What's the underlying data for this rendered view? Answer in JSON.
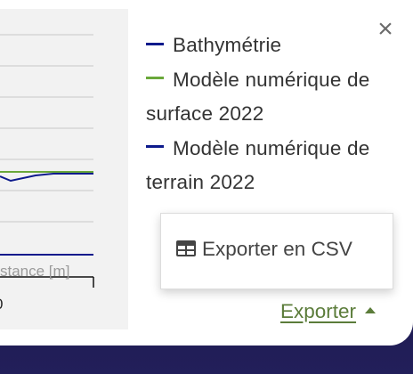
{
  "chart": {
    "xlabel": "stance [m]",
    "tick_label": "0"
  },
  "legend": {
    "items": [
      {
        "label": "Bathymétrie",
        "color": "#0d1a8c"
      },
      {
        "label": "Modèle numérique de surface 2022",
        "color": "#6aa83a"
      },
      {
        "label": "Modèle numérique de terrain 2022",
        "color": "#0d1a8c"
      }
    ]
  },
  "close": {
    "icon": "close-icon",
    "glyph": "×"
  },
  "export_menu": {
    "items": [
      {
        "label": "Exporter en CSV",
        "icon": "table-icon"
      }
    ]
  },
  "export_toggle": {
    "label": "Exporter",
    "icon": "caret-up-icon"
  },
  "colors": {
    "accent_link": "#5b7c3a",
    "series_blue": "#0d1a8c",
    "series_green": "#6aa83a",
    "background": "#201a4e"
  }
}
